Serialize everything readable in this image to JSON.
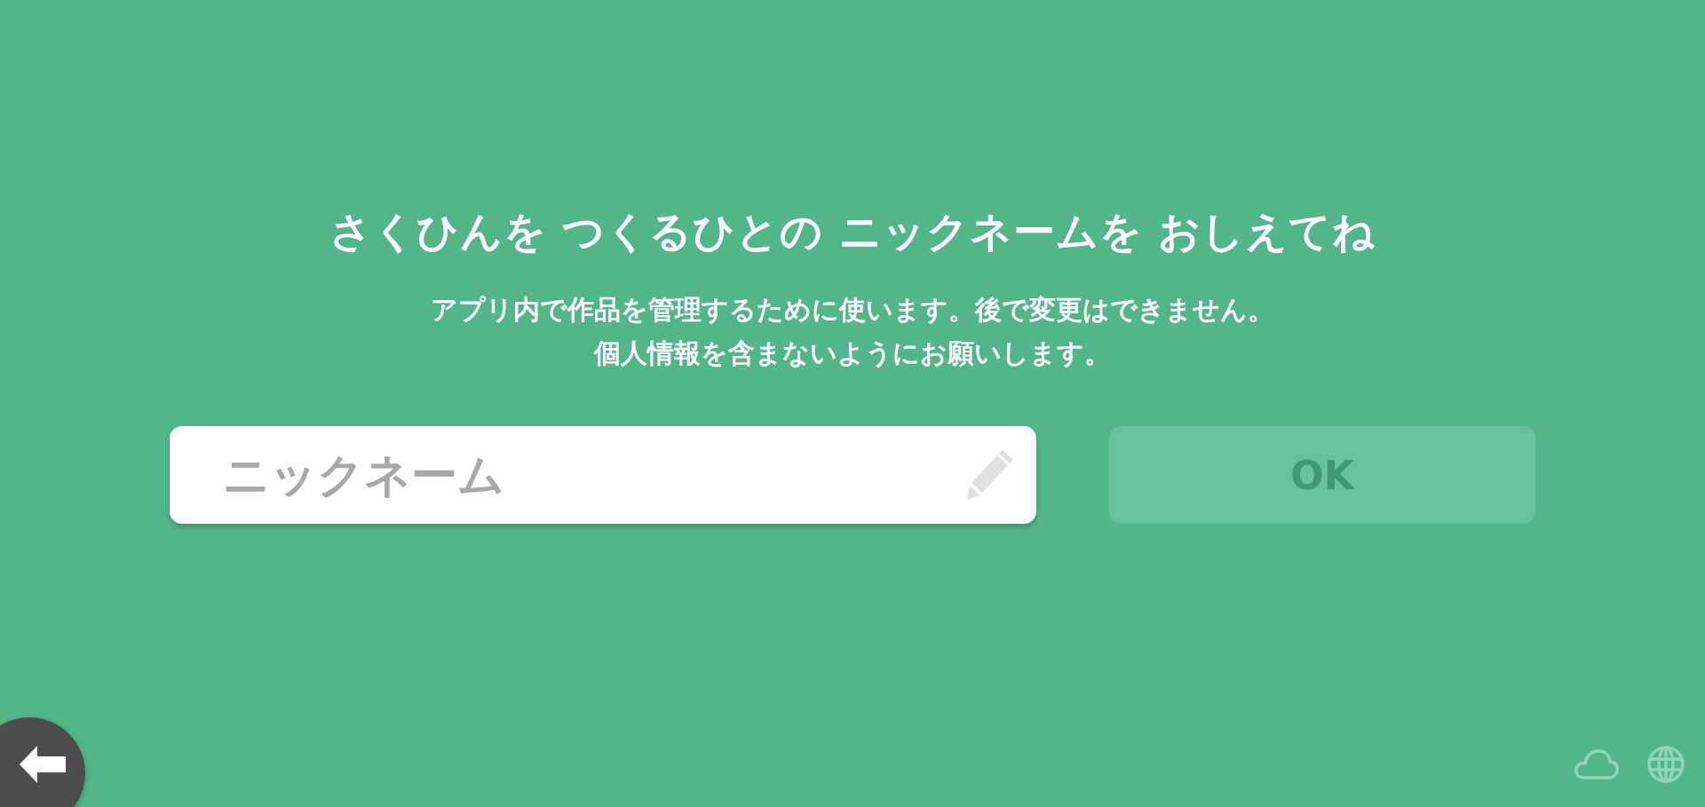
{
  "title": "さくひんを つくるひとの ニックネームを おしえてね",
  "description": [
    "アプリ内で作品を管理するために使います。後で変更はできません。",
    "個人情報を含まないようにお願いします。"
  ],
  "nickname_field": {
    "placeholder": "ニックネーム"
  },
  "ok_button": {
    "label": "OK",
    "disabled": true
  }
}
